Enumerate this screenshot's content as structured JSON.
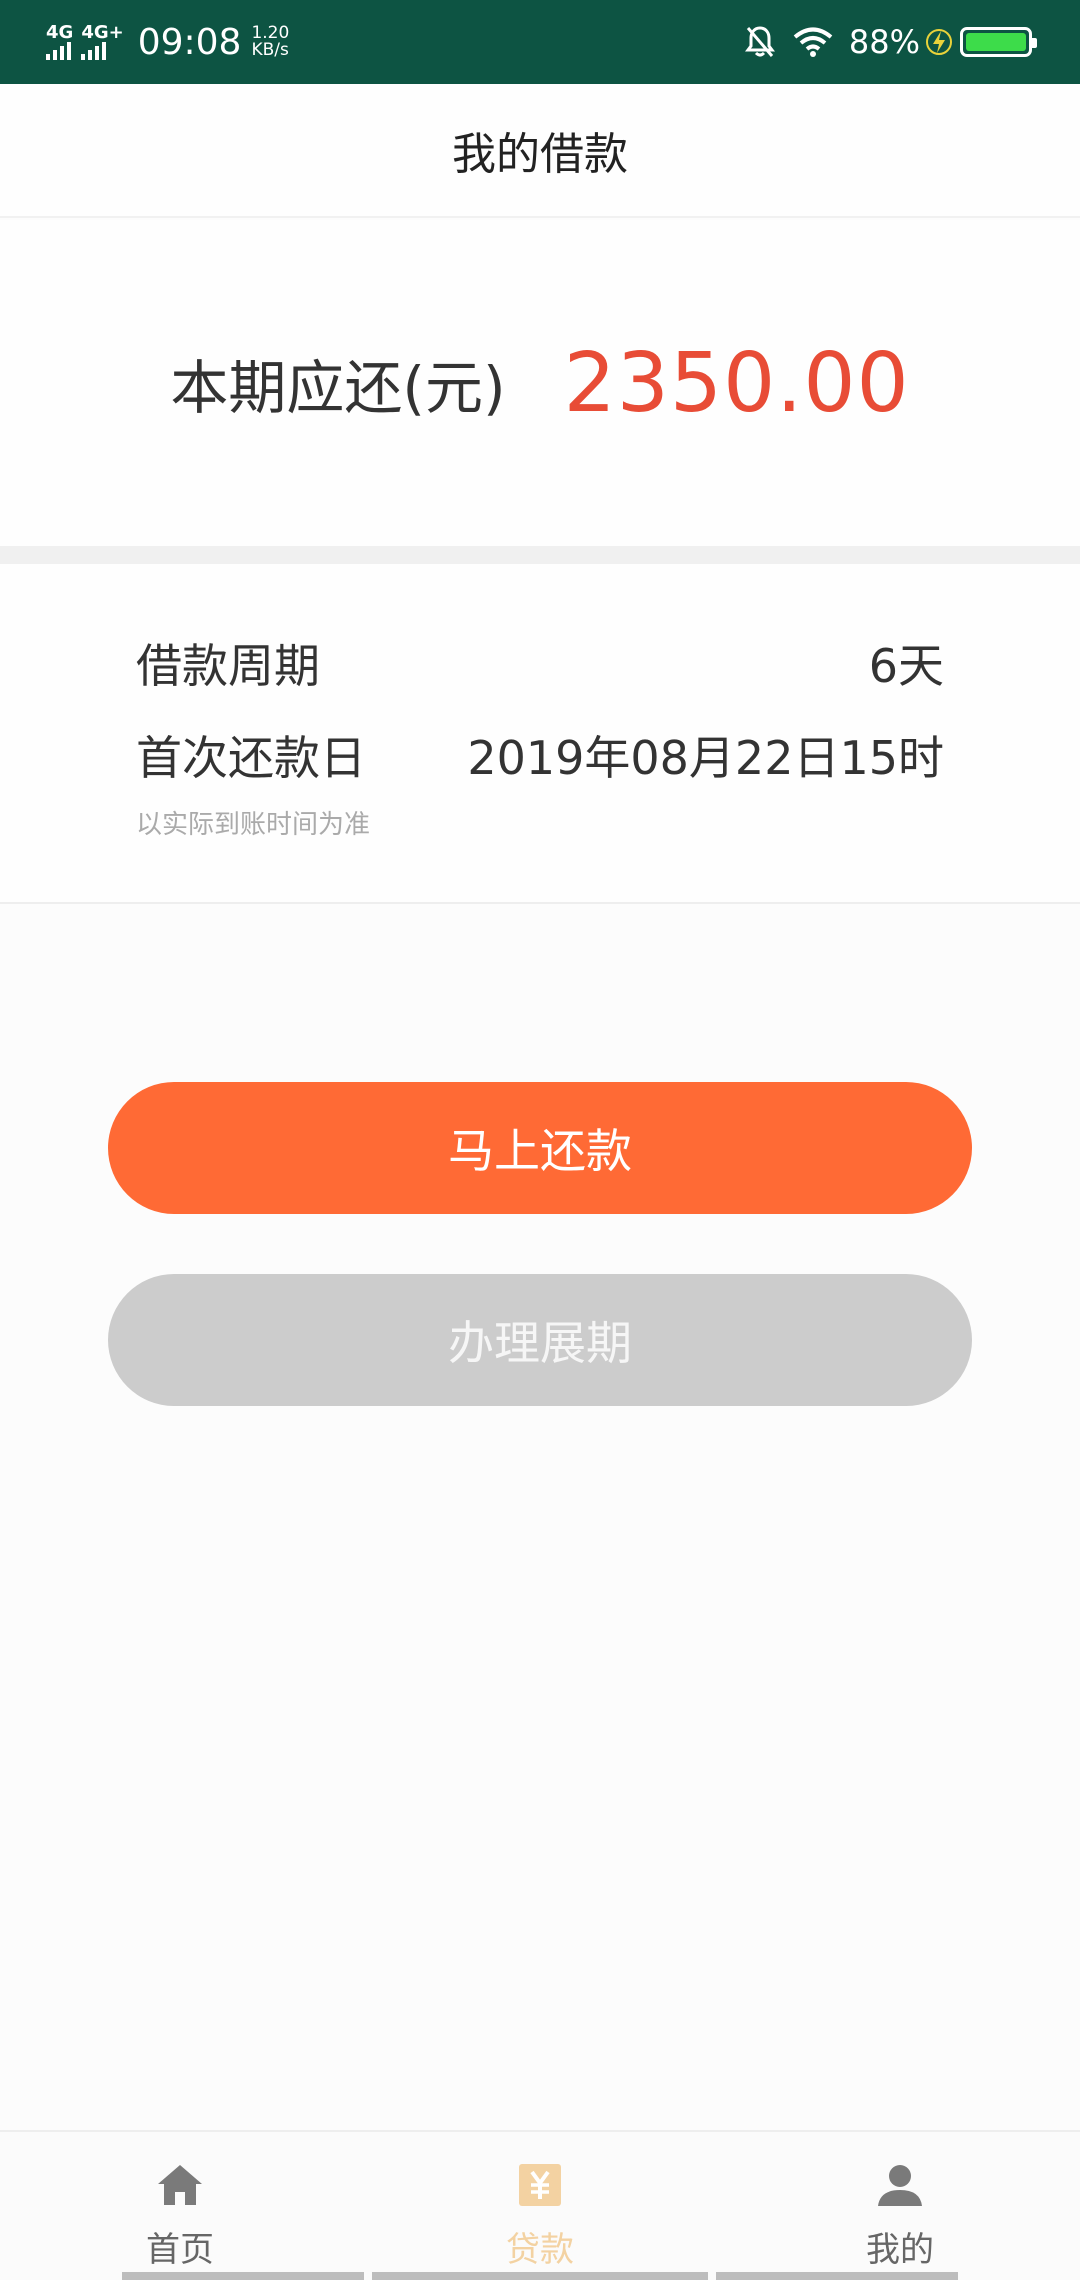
{
  "status_bar": {
    "network_1": "4G",
    "network_2": "4G+",
    "time": "09:08",
    "speed_value": "1.20",
    "speed_unit": "KB/s",
    "battery_percent": "88%"
  },
  "header": {
    "title": "我的借款"
  },
  "amount": {
    "label": "本期应还(元)",
    "value": "2350.00",
    "value_color": "#e84c36"
  },
  "details": {
    "period_label": "借款周期",
    "period_value": "6天",
    "first_repay_label": "首次还款日",
    "first_repay_value": "2019年08月22日15时",
    "note": "以实际到账时间为准"
  },
  "actions": {
    "repay_label": "马上还款",
    "repay_color": "#ff6a35",
    "extend_label": "办理展期",
    "extend_color": "#cccccc"
  },
  "bottom_nav": {
    "items": [
      {
        "label": "首页",
        "icon": "home-icon",
        "active": false
      },
      {
        "label": "贷款",
        "icon": "yuan-icon",
        "active": true
      },
      {
        "label": "我的",
        "icon": "person-icon",
        "active": false
      }
    ],
    "active_color": "#f3d2a2"
  }
}
